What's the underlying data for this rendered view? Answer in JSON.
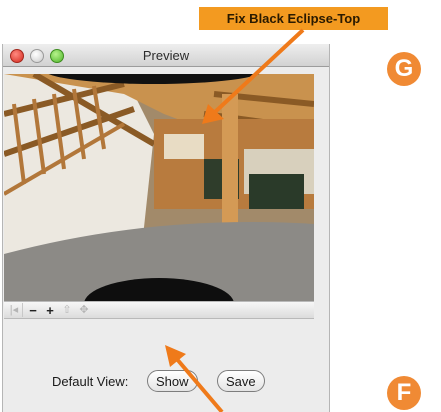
{
  "callout": {
    "text": "Fix Black Eclipse-Top"
  },
  "window": {
    "title": "Preview",
    "traffic_lights": [
      "close-icon",
      "minimize-icon",
      "zoom-icon"
    ]
  },
  "controls": {
    "items": [
      {
        "name": "go-to-start-icon",
        "glyph": "|◂",
        "enabled": false
      },
      {
        "name": "zoom-out-icon",
        "glyph": "−",
        "enabled": true
      },
      {
        "name": "zoom-in-icon",
        "glyph": "+",
        "enabled": true
      },
      {
        "name": "hotspot-up-icon",
        "glyph": "⇧",
        "enabled": false
      },
      {
        "name": "pan-move-icon",
        "glyph": "✥",
        "enabled": false
      }
    ]
  },
  "default_view": {
    "label": "Default View:",
    "show_label": "Show",
    "save_label": "Save"
  },
  "badges": {
    "top": "G",
    "bottom": "F"
  },
  "colors": {
    "accent": "#f39a20",
    "badge": "#f08a34",
    "arrow": "#ef7a1a"
  }
}
